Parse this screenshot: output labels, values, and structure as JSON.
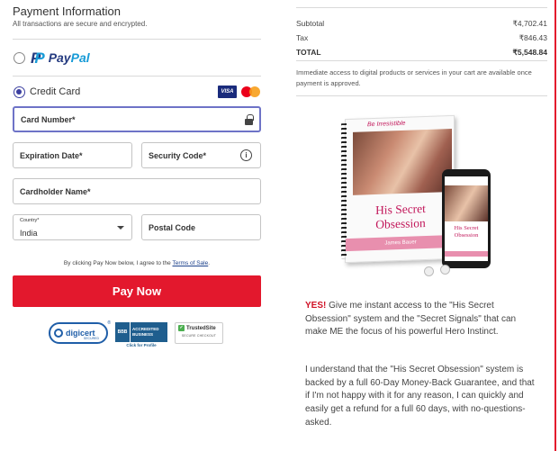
{
  "payment": {
    "title": "Payment Information",
    "subtitle": "All transactions are secure and encrypted.",
    "paypal_label": "PayPal",
    "credit_card_label": "Credit Card",
    "card_brands": [
      "VISA",
      "mastercard"
    ],
    "fields": {
      "card_number": "Card Number*",
      "expiration": "Expiration Date*",
      "security_code": "Security Code*",
      "cardholder": "Cardholder Name*",
      "country_label": "Country*",
      "country_value": "India",
      "postal": "Postal Code"
    },
    "agree_text": "By clicking Pay Now below, I agree to the",
    "terms_link": "Terms of Sale",
    "agree_end": ".",
    "pay_button": "Pay Now",
    "selected_method": "credit_card"
  },
  "badges": {
    "digicert": "digicert",
    "digicert_sub": "SECURED",
    "bbb_logo": "BBB",
    "bbb_line1": "ACCREDITED",
    "bbb_line2": "BUSINESS",
    "bbb_click": "Click for Profile",
    "trustedsite": "TrustedSite",
    "trustedsite_sub": "SECURE CHECKOUT"
  },
  "summary": {
    "subtotal_label": "Subtotal",
    "subtotal_value": "₹4,702.41",
    "tax_label": "Tax",
    "tax_value": "₹846.43",
    "total_label": "TOTAL",
    "total_value": "₹5,548.84",
    "note": "Immediate access to digital products or services in your cart are available once payment is approved."
  },
  "product": {
    "brand": "Be Irresistible",
    "title_line1": "His Secret",
    "title_line2": "Obsession",
    "author": "James Bauer",
    "phone_title1": "His Secret",
    "phone_title2": "Obsession",
    "phone_author": "James Bauer"
  },
  "copy": {
    "yes": "YES!",
    "yes_text": " Give me instant access to the \"His Secret Obsession\" system and the \"Secret Signals\" that can make ME the focus of his powerful Hero Instinct.",
    "guarantee": "I understand that the \"His Secret Obsession\" system is backed by a full 60-Day Money-Back Guarantee, and that if I'm not happy with it for any reason, I can quickly and easily get a refund for a full 60 days, with no-questions-asked."
  },
  "colors": {
    "accent_red": "#e3182d",
    "radio_selected": "#3b3fa0",
    "focus_border": "#6e73c7",
    "paypal_dark": "#253b80",
    "paypal_light": "#179bd7"
  }
}
